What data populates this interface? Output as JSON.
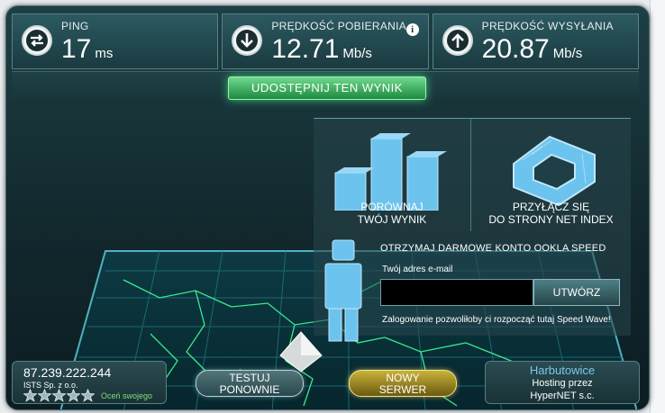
{
  "stats": {
    "ping": {
      "label": "PING",
      "value": "17",
      "unit": "ms",
      "icon": "swap-arrows-icon"
    },
    "download": {
      "label": "PRĘDKOŚĆ POBIERANIA",
      "value": "12.71",
      "unit": "Mb/s",
      "icon": "arrow-down-icon"
    },
    "upload": {
      "label": "PRĘDKOŚĆ WYSYŁANIA",
      "value": "20.87",
      "unit": "Mb/s",
      "icon": "arrow-up-icon"
    },
    "info_symbol": "i"
  },
  "share": {
    "label": "UDOSTĘPNIJ TEN WYNIK"
  },
  "panels": {
    "compare": {
      "line1": "PORÓWNAJ",
      "line2": "TWÓJ WYNIK"
    },
    "connect": {
      "line1": "PRZYŁĄCZ SIĘ",
      "line2": "DO STRONY NET INDEX"
    }
  },
  "signup": {
    "title": "OTRZYMAJ DARMOWE KONTO OOKLA SPEED",
    "email_label": "Twój adres e-mail",
    "email_value": "",
    "create_label": "UTWÓRZ",
    "note": "Zalogowanie pozwoliłoby ci rozpocząć tutaj Speed Wave!"
  },
  "client": {
    "ip": "87.239.222.244",
    "isp": "ISTS Sp. z o.o.",
    "stars": 5,
    "rate_label": "Oceń swojego"
  },
  "buttons": {
    "retest": {
      "line1": "TESTUJ",
      "line2": "PONOWNIE"
    },
    "new_server": {
      "line1": "NOWY",
      "line2": "SERWER"
    }
  },
  "server": {
    "city": "Harbutowice",
    "line1": "Hosting przez",
    "line2": "HyperNET s.c."
  },
  "colors": {
    "accent_green": "#2fd06a",
    "accent_gold": "#c9b23a",
    "frame_teal": "#1d3f45",
    "map_line": "#3cff9a"
  }
}
